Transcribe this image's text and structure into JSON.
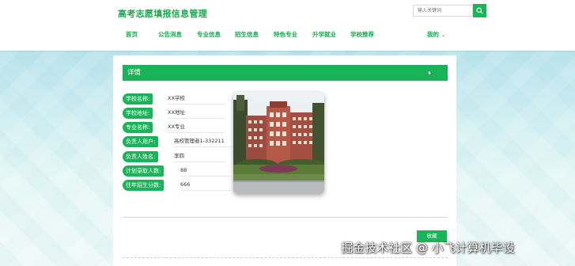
{
  "header": {
    "title": "高考志愿填报信息管理",
    "search_placeholder": "输入关键词"
  },
  "nav": {
    "items": [
      {
        "label": "首页"
      },
      {
        "label": "公告消息"
      },
      {
        "label": "专业信息"
      },
      {
        "label": "招生信息"
      },
      {
        "label": "特色专业"
      },
      {
        "label": "升学就业"
      },
      {
        "label": "学校推荐"
      }
    ],
    "account_label": "我的"
  },
  "detail": {
    "heading": "详情",
    "fields": [
      {
        "label": "学校名称:",
        "value": "XX学校"
      },
      {
        "label": "学校地址:",
        "value": "XX地址"
      },
      {
        "label": "专业名称:",
        "value": "XX专业"
      },
      {
        "label": "负责人用户:",
        "value": "高校管理者1-332211"
      },
      {
        "label": "负责人姓名:",
        "value": "李四"
      },
      {
        "label": "计划录取人数:",
        "value": "88"
      },
      {
        "label": "往年招生分数:",
        "value": "666"
      }
    ],
    "collect_label": "收藏"
  },
  "watermark": "掘金技术社区 @ 小飞计算机毕设",
  "colors": {
    "primary": "#19b359",
    "title": "#1aa84f"
  },
  "icons": [
    "search-icon",
    "chevron-down-icon",
    "cursor-icon",
    "school-building-photo"
  ]
}
